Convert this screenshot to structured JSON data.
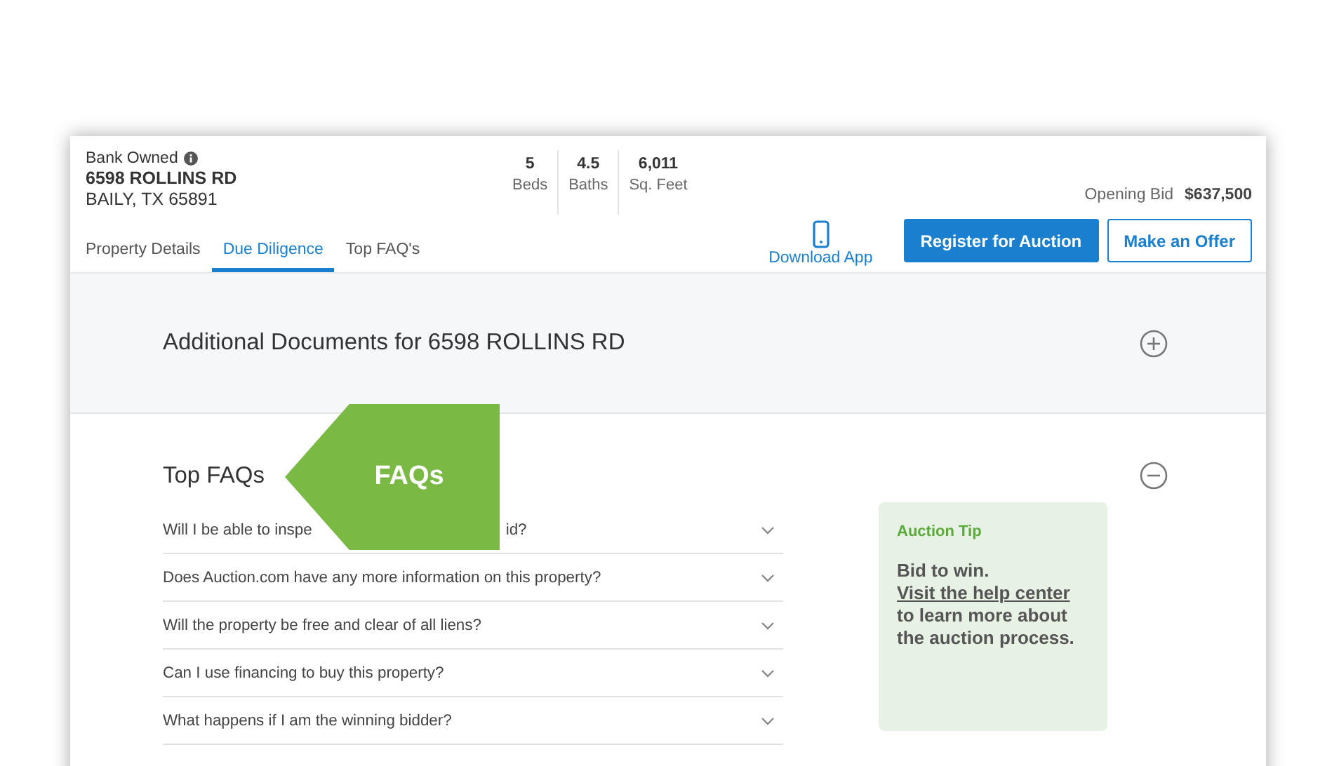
{
  "property": {
    "status": "Bank Owned",
    "address": "6598 ROLLINS RD",
    "city": "BAILY, TX 65891"
  },
  "stats": [
    {
      "value": "5",
      "label": "Beds"
    },
    {
      "value": "4.5",
      "label": "Baths"
    },
    {
      "value": "6,011",
      "label": "Sq. Feet"
    }
  ],
  "tabs": [
    {
      "label": "Property Details",
      "selected": false
    },
    {
      "label": "Due Diligence",
      "selected": true
    },
    {
      "label": "Top FAQ's",
      "selected": false
    }
  ],
  "opening_bid": {
    "label": "Opening Bid",
    "value": "$637,500"
  },
  "download_app": "Download App",
  "buttons": [
    {
      "label": "Register for Auction",
      "kind": "primary"
    },
    {
      "label": "Make an Offer",
      "kind": "secondary"
    }
  ],
  "documents_section": {
    "title": "Additional Documents for",
    "address": "6598 ROLLINS RD",
    "expanded": false
  },
  "faq_section": {
    "title": "Top FAQs",
    "expanded": true
  },
  "faqs": [
    {
      "question": "Will I be able to inspe",
      "question_tail": "id?",
      "expanded": false
    },
    {
      "question": "Does Auction.com have any more information on this property?",
      "expanded": false
    },
    {
      "question": "Will the property be free and clear of all liens?",
      "expanded": false
    },
    {
      "question": "Can I use financing to buy this property?",
      "expanded": false
    },
    {
      "question": "What happens if I am the winning bidder?",
      "expanded": false
    }
  ],
  "tip": {
    "title": "Auction Tip",
    "lead": "Bid to win.",
    "link": "Visit the help center",
    "rest": "to learn more about the auction process."
  },
  "callout": {
    "label": "FAQs"
  }
}
